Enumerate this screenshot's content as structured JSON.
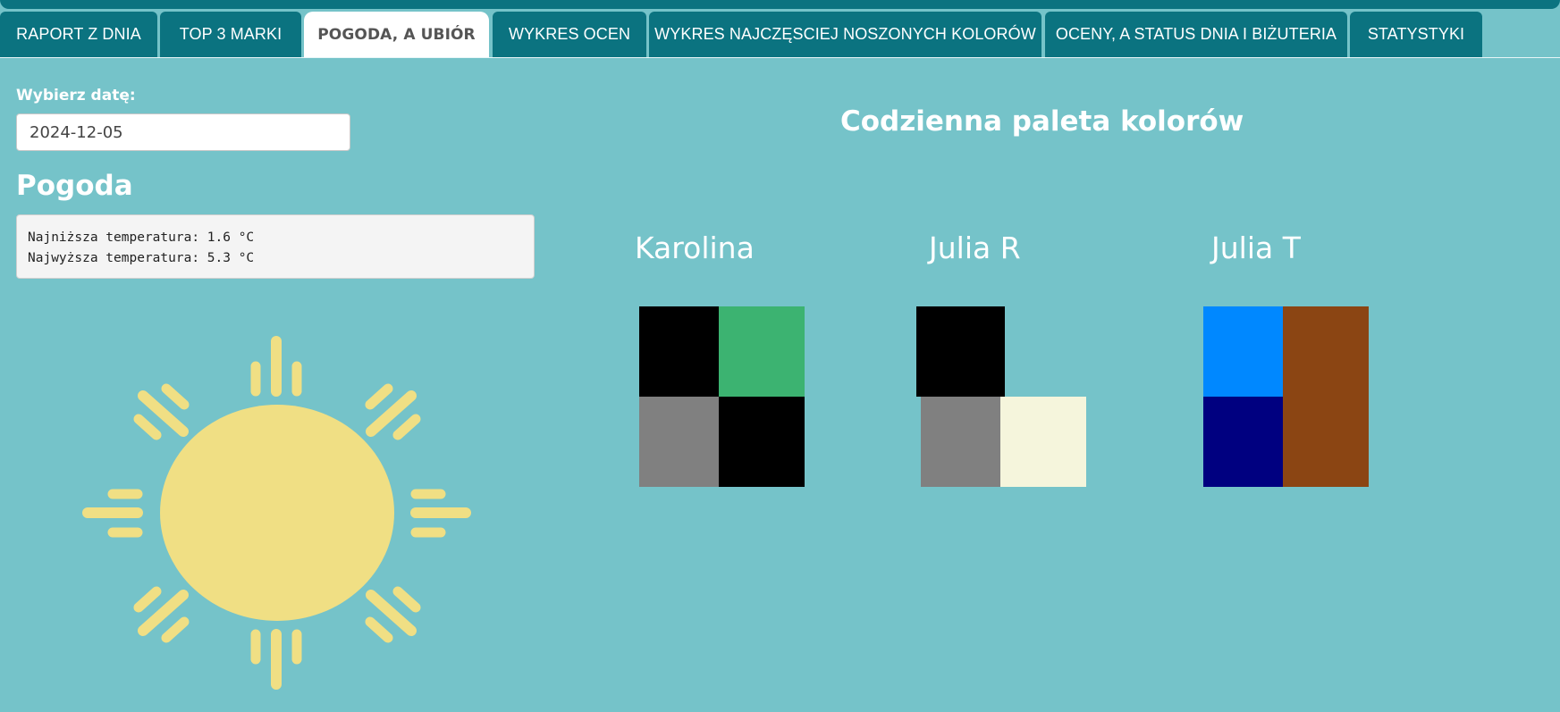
{
  "tabs": [
    {
      "label": "RAPORT Z DNIA",
      "active": false
    },
    {
      "label": "TOP 3 MARKI",
      "active": false
    },
    {
      "label": "POGODA, A UBIÓR",
      "active": true
    },
    {
      "label": "WYKRES OCEN",
      "active": false
    },
    {
      "label": "WYKRES NAJCZĘSCIEJ NOSZONYCH KOLORÓW",
      "active": false
    },
    {
      "label": "OCENY, A STATUS DNIA I BIŻUTERIA",
      "active": false
    },
    {
      "label": "STATYSTYKI",
      "active": false
    }
  ],
  "date_picker": {
    "label": "Wybierz datę:",
    "value": "2024-12-05"
  },
  "weather": {
    "title": "Pogoda",
    "min_line": "Najniższa temperatura: 1.6 °C",
    "max_line": "Najwyższa temperatura: 5.3 °C",
    "icon": "sun-icon"
  },
  "palette": {
    "title": "Codzienna paleta kolorów",
    "people": [
      {
        "name": "Karolina",
        "colors": [
          "#000000",
          "#3cb371",
          "#808080",
          "#000000"
        ]
      },
      {
        "name": "Julia R",
        "colors": [
          "#000000",
          "#808080",
          "#f5f5dc"
        ]
      },
      {
        "name": "Julia T",
        "colors": [
          "#0088ff",
          "#8b4513",
          "#000080",
          "#8b4513"
        ]
      }
    ]
  },
  "colors": {
    "background": "#75c3c9",
    "tab_bg": "#0b7380",
    "sun": "#f0df84"
  }
}
